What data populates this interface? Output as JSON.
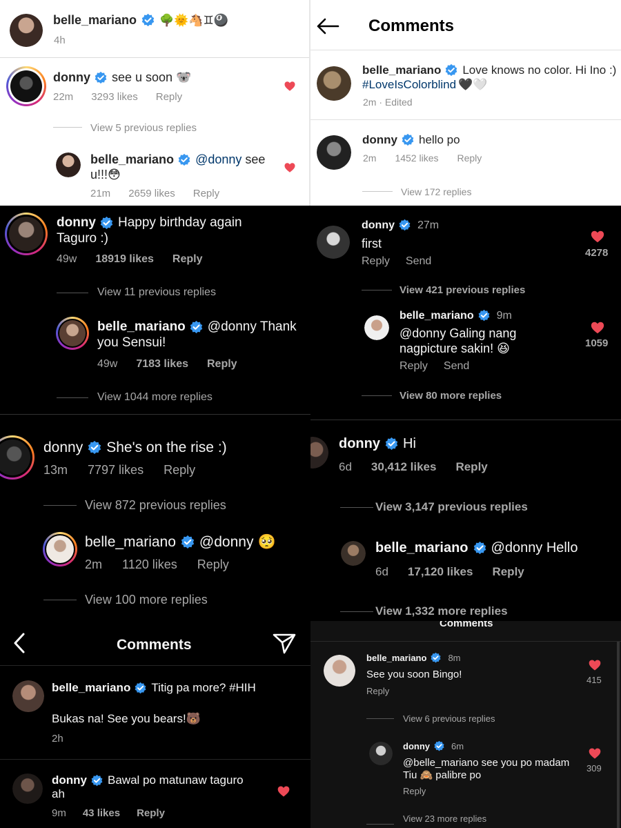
{
  "p1": {
    "header": {
      "user": "belle_mariano",
      "emoji": "🌳🌞🐴♊🎱",
      "time": "4h"
    },
    "comment": {
      "user": "donny",
      "text": "see u soon 🐨",
      "time": "22m",
      "likes": "3293 likes",
      "reply": "Reply"
    },
    "view": "View 5 previous replies",
    "reply": {
      "user": "belle_mariano",
      "mention": "@donny",
      "text1": "see",
      "text2": "u!!!😳",
      "time": "21m",
      "likes": "2659 likes",
      "reply": "Reply"
    }
  },
  "p2": {
    "title": "Comments",
    "caption": {
      "user": "belle_mariano",
      "text": "Love knows no color. Hi Ino :)",
      "hashtag": "#LoveIsColorblind",
      "hearts": "🖤🤍",
      "meta": "2m · Edited"
    },
    "comment": {
      "user": "donny",
      "text": "hello po",
      "time": "2m",
      "likes": "1452 likes",
      "reply": "Reply"
    },
    "view": "View 172 replies"
  },
  "p3": {
    "comment": {
      "user": "donny",
      "text1": "Happy birthday again",
      "text2": "Taguro :)",
      "time": "49w",
      "likes": "18919 likes",
      "reply": "Reply"
    },
    "view_prev": "View 11 previous replies",
    "reply": {
      "user": "belle_mariano",
      "mention": "@donny",
      "text1": "Thank",
      "text2": "you Sensui!",
      "time": "49w",
      "likes": "7183 likes",
      "reply": "Reply"
    },
    "view_more": "View 1044 more replies"
  },
  "p4": {
    "comment": {
      "user": "donny",
      "time": "27m",
      "text": "first",
      "reply": "Reply",
      "send": "Send",
      "likes": "4278"
    },
    "view_prev": "View 421 previous replies",
    "reply": {
      "user": "belle_mariano",
      "time": "9m",
      "text1": "@donny Galing nang",
      "text2": "nagpicture sakin! 😆",
      "reply": "Reply",
      "send": "Send",
      "likes": "1059"
    },
    "view_more": "View 80 more replies"
  },
  "p5": {
    "comment": {
      "user": "donny",
      "text": "She's on the rise :)",
      "time": "13m",
      "likes": "7797 likes",
      "reply": "Reply"
    },
    "view_prev": "View 872 previous replies",
    "reply": {
      "user": "belle_mariano",
      "mention": "@donny",
      "emoji": "🥺",
      "time": "2m",
      "likes": "1120 likes",
      "reply": "Reply"
    },
    "view_more": "View 100 more replies"
  },
  "p6": {
    "comment": {
      "user": "donny",
      "text": "Hi",
      "time": "6d",
      "likes": "30,412 likes",
      "reply": "Reply"
    },
    "view_prev": "View 3,147 previous replies",
    "reply": {
      "user": "belle_mariano",
      "text": "@donny Hello",
      "time": "6d",
      "likes": "17,120 likes",
      "reply": "Reply"
    },
    "view_more": "View 1,332 more replies"
  },
  "p7": {
    "title": "Comments",
    "comment": {
      "user": "belle_mariano",
      "text": "Titig pa more? #HIH",
      "text2": "Bukas na! See you bears!🐻",
      "time": "2h"
    },
    "comment2": {
      "user": "donny",
      "text1": "Bawal po matunaw taguro",
      "text2": "ah",
      "time": "9m",
      "likes": "43 likes",
      "reply": "Reply"
    }
  },
  "p8": {
    "title": "Comments",
    "comment": {
      "user": "belle_mariano",
      "time": "8m",
      "text": "See you soon Bingo!",
      "reply": "Reply",
      "likes": "415"
    },
    "view_prev": "View 6 previous replies",
    "reply": {
      "user": "donny",
      "time": "6m",
      "text1": "@belle_mariano see you po madam",
      "text2": "Tiu 🙈 palibre po",
      "reply": "Reply",
      "likes": "309"
    },
    "view_more": "View 23 more replies"
  },
  "colors": {
    "verified": "#3897f0",
    "heart": "#ed4956",
    "light_bg": "#ffffff",
    "dark_bg": "#000000"
  }
}
